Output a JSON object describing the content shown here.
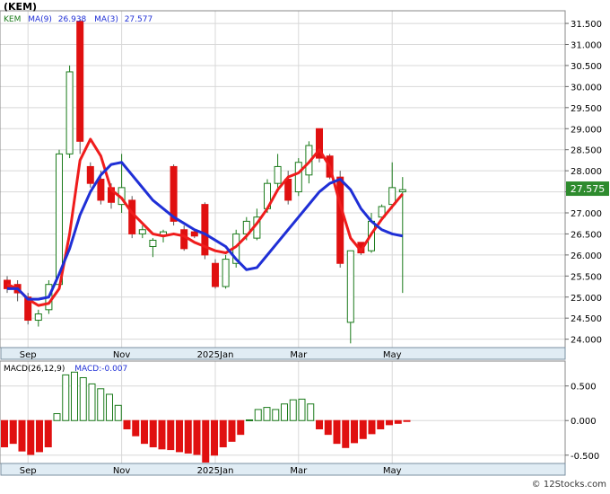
{
  "title": "(KEM)",
  "footer": "© 12Stocks.com",
  "colors": {
    "ma9": "#1f2fd6",
    "ma3": "#ef1c1c",
    "up_candle": "#1a7a1a",
    "down_candle": "#e01010",
    "grid": "#d8d8d8",
    "axis_strip": "#e0ecf4",
    "last_price_bg": "#2e8b2e"
  },
  "chart_data": [
    {
      "type": "candlestick",
      "legend": [
        {
          "label": "KEM",
          "color": "#1a7a1a"
        },
        {
          "label": "MA(9)",
          "value": "26.938",
          "color": "#1f2fd6"
        },
        {
          "label": "MA(3)",
          "value": "27.577",
          "color": "#ef1c1c"
        }
      ],
      "ylim": [
        23.8,
        31.8
      ],
      "yticks": [
        "24.000",
        "24.500",
        "25.000",
        "25.500",
        "26.000",
        "26.500",
        "27.000",
        "27.500",
        "28.000",
        "28.500",
        "29.000",
        "29.500",
        "30.000",
        "30.500",
        "31.000",
        "31.500"
      ],
      "xticks": [
        {
          "label": "Sep",
          "i": 2
        },
        {
          "label": "Nov",
          "i": 11
        },
        {
          "label": "2025Jan",
          "i": 20
        },
        {
          "label": "Mar",
          "i": 28
        },
        {
          "label": "May",
          "i": 37
        }
      ],
      "last_price": "27.575",
      "candles": [
        {
          "o": 25.4,
          "h": 25.5,
          "l": 25.1,
          "c": 25.2
        },
        {
          "o": 25.3,
          "h": 25.4,
          "l": 24.9,
          "c": 25.1
        },
        {
          "o": 25.0,
          "h": 25.1,
          "l": 24.35,
          "c": 24.45
        },
        {
          "o": 24.45,
          "h": 24.7,
          "l": 24.3,
          "c": 24.6
        },
        {
          "o": 24.7,
          "h": 25.4,
          "l": 24.6,
          "c": 25.3
        },
        {
          "o": 25.3,
          "h": 28.5,
          "l": 25.2,
          "c": 28.4
        },
        {
          "o": 28.4,
          "h": 30.5,
          "l": 28.3,
          "c": 30.35
        },
        {
          "o": 31.55,
          "h": 31.6,
          "l": 28.4,
          "c": 28.7
        },
        {
          "o": 28.1,
          "h": 28.2,
          "l": 27.6,
          "c": 27.7
        },
        {
          "o": 27.8,
          "h": 28.0,
          "l": 27.2,
          "c": 27.3
        },
        {
          "o": 27.6,
          "h": 27.7,
          "l": 27.1,
          "c": 27.25
        },
        {
          "o": 27.2,
          "h": 28.4,
          "l": 27.0,
          "c": 27.6
        },
        {
          "o": 27.3,
          "h": 27.4,
          "l": 26.4,
          "c": 26.5
        },
        {
          "o": 26.5,
          "h": 26.7,
          "l": 26.4,
          "c": 26.6
        },
        {
          "o": 26.2,
          "h": 26.4,
          "l": 25.95,
          "c": 26.35
        },
        {
          "o": 26.45,
          "h": 26.6,
          "l": 26.3,
          "c": 26.55
        },
        {
          "o": 28.1,
          "h": 28.15,
          "l": 26.7,
          "c": 26.8
        },
        {
          "o": 26.6,
          "h": 26.7,
          "l": 26.1,
          "c": 26.15
        },
        {
          "o": 26.55,
          "h": 26.6,
          "l": 26.4,
          "c": 26.45
        },
        {
          "o": 27.2,
          "h": 27.25,
          "l": 25.9,
          "c": 26.0
        },
        {
          "o": 25.8,
          "h": 25.9,
          "l": 25.2,
          "c": 25.25
        },
        {
          "o": 25.25,
          "h": 26.0,
          "l": 25.2,
          "c": 25.9
        },
        {
          "o": 25.8,
          "h": 26.6,
          "l": 25.7,
          "c": 26.5
        },
        {
          "o": 26.5,
          "h": 26.9,
          "l": 26.35,
          "c": 26.8
        },
        {
          "o": 26.4,
          "h": 27.1,
          "l": 26.35,
          "c": 26.9
        },
        {
          "o": 27.1,
          "h": 27.8,
          "l": 27.0,
          "c": 27.7
        },
        {
          "o": 27.7,
          "h": 28.4,
          "l": 27.6,
          "c": 28.1
        },
        {
          "o": 27.8,
          "h": 28.0,
          "l": 27.2,
          "c": 27.3
        },
        {
          "o": 27.5,
          "h": 28.3,
          "l": 27.4,
          "c": 28.2
        },
        {
          "o": 27.9,
          "h": 28.7,
          "l": 27.7,
          "c": 28.6
        },
        {
          "o": 29.0,
          "h": 29.0,
          "l": 28.2,
          "c": 28.3
        },
        {
          "o": 28.35,
          "h": 28.4,
          "l": 27.8,
          "c": 27.85
        },
        {
          "o": 27.85,
          "h": 28.0,
          "l": 25.7,
          "c": 25.8
        },
        {
          "o": 24.4,
          "h": 26.0,
          "l": 23.9,
          "c": 26.1
        },
        {
          "o": 26.3,
          "h": 26.3,
          "l": 26.0,
          "c": 26.05
        },
        {
          "o": 26.1,
          "h": 27.0,
          "l": 26.05,
          "c": 26.8
        },
        {
          "o": 26.9,
          "h": 27.2,
          "l": 26.85,
          "c": 27.15
        },
        {
          "o": 27.2,
          "h": 28.2,
          "l": 27.1,
          "c": 27.6
        },
        {
          "o": 27.5,
          "h": 27.85,
          "l": 25.1,
          "c": 27.55
        }
      ],
      "ma9": [
        25.2,
        25.2,
        24.95,
        24.95,
        25.0,
        25.55,
        26.15,
        26.95,
        27.5,
        27.9,
        28.15,
        28.2,
        27.9,
        27.6,
        27.3,
        27.1,
        26.9,
        26.75,
        26.6,
        26.5,
        26.35,
        26.2,
        25.9,
        25.65,
        25.7,
        26.0,
        26.3,
        26.6,
        26.9,
        27.2,
        27.5,
        27.7,
        27.8,
        27.55,
        27.1,
        26.8,
        26.6,
        26.5,
        26.45
      ],
      "ma3": [
        25.3,
        25.2,
        24.95,
        24.8,
        24.85,
        25.2,
        26.5,
        28.25,
        28.75,
        28.35,
        27.55,
        27.35,
        27.0,
        26.75,
        26.5,
        26.45,
        26.5,
        26.45,
        26.3,
        26.2,
        26.1,
        26.05,
        26.2,
        26.45,
        26.75,
        27.1,
        27.55,
        27.85,
        27.95,
        28.2,
        28.5,
        28.1,
        27.2,
        26.4,
        26.1,
        26.5,
        26.85,
        27.15,
        27.45
      ],
      "macd_legend": "MACD(26,12,9)",
      "macd_value_label": "MACD:-0.007",
      "macd_ylim": [
        -0.62,
        0.86
      ],
      "macd_yticks": [
        "-0.500",
        "0.000",
        "0.500"
      ],
      "macd": [
        -0.38,
        -0.33,
        -0.44,
        -0.49,
        -0.45,
        -0.38,
        0.1,
        0.66,
        0.7,
        0.62,
        0.53,
        0.46,
        0.38,
        0.22,
        -0.12,
        -0.22,
        -0.33,
        -0.38,
        -0.41,
        -0.42,
        -0.45,
        -0.47,
        -0.49,
        -0.6,
        -0.5,
        -0.38,
        -0.3,
        -0.2,
        0.01,
        0.16,
        0.19,
        0.16,
        0.24,
        0.3,
        0.31,
        0.24,
        -0.12,
        -0.2,
        -0.33,
        -0.39,
        -0.32,
        -0.26,
        -0.19,
        -0.12,
        -0.06,
        -0.04,
        -0.007
      ]
    }
  ]
}
